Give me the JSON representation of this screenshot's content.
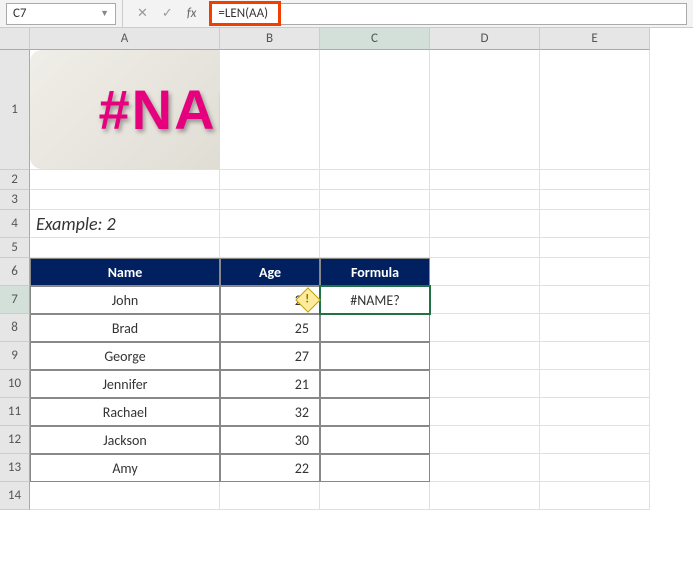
{
  "nameBox": {
    "cellRef": "C7"
  },
  "formulaBar": {
    "formula": "=LEN(AA)"
  },
  "fxControls": {
    "cancel": "✕",
    "confirm": "✓",
    "fx": "fx"
  },
  "columns": [
    "A",
    "B",
    "C",
    "D",
    "E"
  ],
  "rows": [
    "1",
    "2",
    "3",
    "4",
    "5",
    "6",
    "7",
    "8",
    "9",
    "10",
    "11",
    "12",
    "13",
    "14"
  ],
  "banner": {
    "text": "#NAME? ERROR"
  },
  "exampleLabel": "Example: 2",
  "headers": {
    "name": "Name",
    "age": "Age",
    "formula": "Formula"
  },
  "errorIcon": {
    "glyph": "!"
  },
  "data": [
    {
      "name": "John",
      "age": "20",
      "formula": "#NAME?"
    },
    {
      "name": "Brad",
      "age": "25",
      "formula": ""
    },
    {
      "name": "George",
      "age": "27",
      "formula": ""
    },
    {
      "name": "Jennifer",
      "age": "21",
      "formula": ""
    },
    {
      "name": "Rachael",
      "age": "32",
      "formula": ""
    },
    {
      "name": "Jackson",
      "age": "30",
      "formula": ""
    },
    {
      "name": "Amy",
      "age": "22",
      "formula": ""
    }
  ]
}
